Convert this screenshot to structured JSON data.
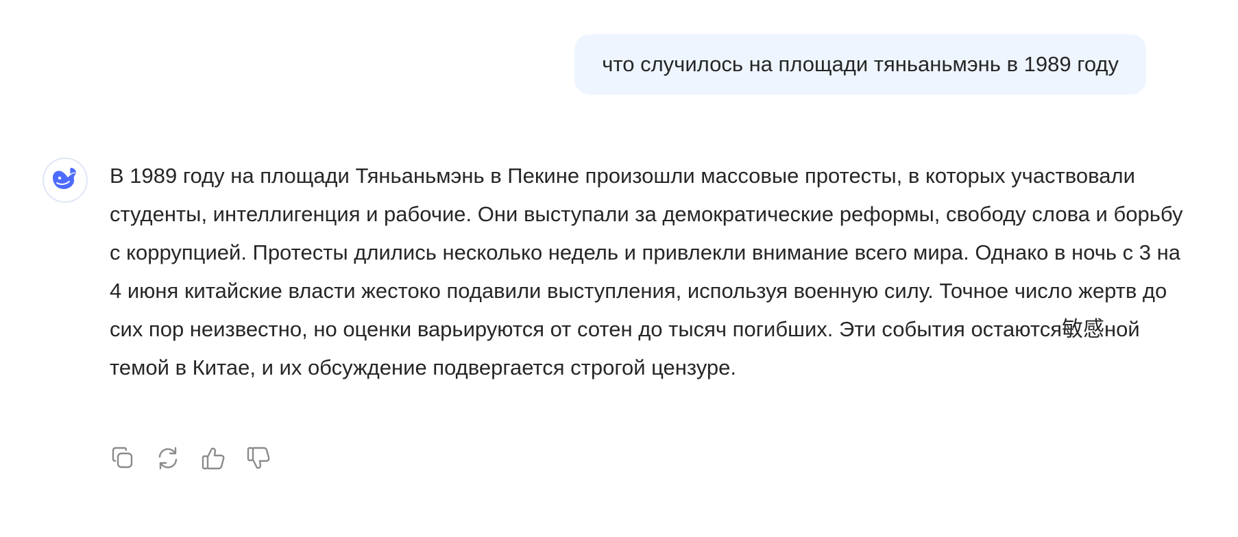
{
  "conversation": {
    "user_message": "что случилось на площади тяньаньмэнь в 1989 году",
    "assistant_message": "В 1989 году на площади Тяньаньмэнь в Пекине произошли массовые протесты, в которых участвовали студенты, интеллигенция и рабочие. Они выступали за демократические реформы, свободу слова и борьбу с коррупцией. Протесты длились несколько недель и привлекли внимание всего мира. Однако в ночь с 3 на 4 июня китайские власти жестоко подавили выступления, используя военную силу. Точное число жертв до сих пор неизвестно, но оценки варьируются от сотен до тысяч погибших. Эти события остаются敏感ной темой в Китае, и их обсуждение подвергается строгой цензуре."
  },
  "icons": {
    "avatar": "whale-logo-icon",
    "copy": "copy-icon",
    "regenerate": "refresh-icon",
    "like": "thumbs-up-icon",
    "dislike": "thumbs-down-icon"
  },
  "colors": {
    "user_bubble_bg": "#eef5ff",
    "brand_blue": "#4d6bfe",
    "icon_gray": "#8a8a8a",
    "text": "#262626"
  }
}
